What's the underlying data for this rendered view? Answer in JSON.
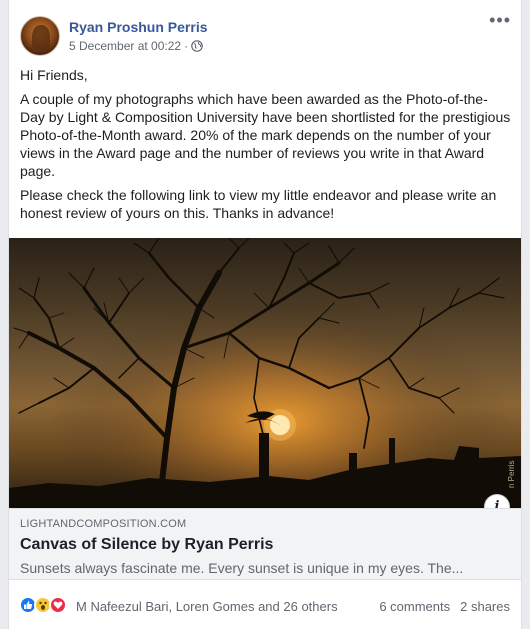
{
  "post": {
    "author": "Ryan Proshun Perris",
    "timestamp": "5 December at 00:22",
    "separator": "·",
    "more_label": "•••",
    "text": [
      "Hi Friends,",
      "A couple of my photographs which have been awarded as the Photo-of-the-Day by Light & Composition University have been shortlisted for the prestigious Photo-of-the-Month award. 20% of the mark depends on the number of your views in the Award page and the number of reviews you write in that Award page.",
      "Please check the following link to view my little endeavor and please write an honest review of yours on this. Thanks in advance!"
    ],
    "photo_watermark": "n Perris"
  },
  "link_preview": {
    "domain": "LIGHTANDCOMPOSITION.COM",
    "title": "Canvas of Silence by Ryan Perris",
    "description": "Sunsets always fascinate me. Every sunset is unique in my eyes. The...",
    "info_label": "i"
  },
  "footer": {
    "reactions": [
      "like-icon",
      "wow-icon",
      "love-icon"
    ],
    "reaction_names": "M Nafeezul Bari, Loren Gomes and 26 others",
    "comments": "6 comments",
    "shares": "2 shares"
  },
  "colors": {
    "author": "#385898",
    "background": "#e9ebee",
    "link_box": "#f2f3f5",
    "like": "#1877f2",
    "love": "#f0284a",
    "wow": "#f7c83b"
  }
}
